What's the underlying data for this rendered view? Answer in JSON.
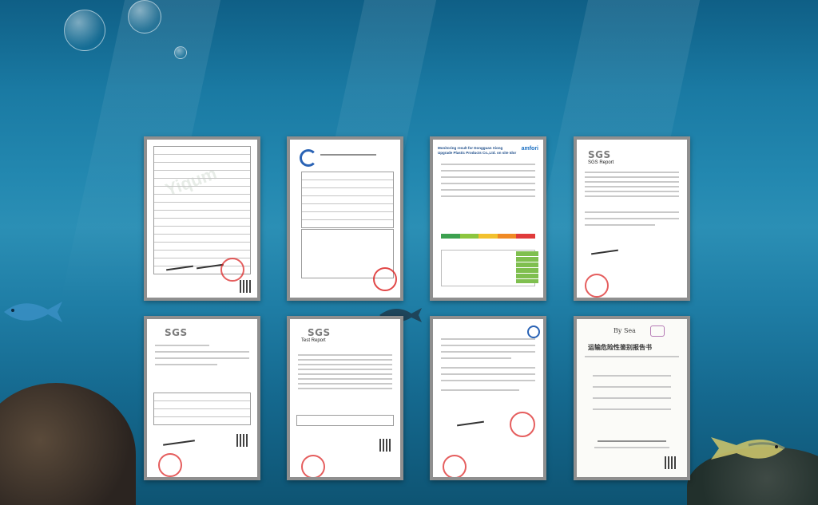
{
  "colors": {
    "sea_top": "#0f5f86",
    "sea_mid": "#2b8fb5",
    "sea_bottom": "#0e5473",
    "frame": "#8f8f8f"
  },
  "certificates": [
    {
      "id": "cert-1",
      "logo": "",
      "title": ""
    },
    {
      "id": "cert-2",
      "logo": "",
      "title": ""
    },
    {
      "id": "cert-3",
      "logo": "amfori",
      "title": "Monitoring result for Dongguan Xiong Upgrade Plastic Products Co.,Ltd. on site Idor"
    },
    {
      "id": "cert-4",
      "logo": "SGS",
      "title": "SGS Report"
    },
    {
      "id": "cert-5",
      "logo": "SGS",
      "title": ""
    },
    {
      "id": "cert-6",
      "logo": "SGS",
      "title": "Test Report"
    },
    {
      "id": "cert-7",
      "logo": "",
      "title": ""
    },
    {
      "id": "cert-8",
      "logo": "By Sea",
      "title": "运输危险性鉴别报告书"
    }
  ]
}
